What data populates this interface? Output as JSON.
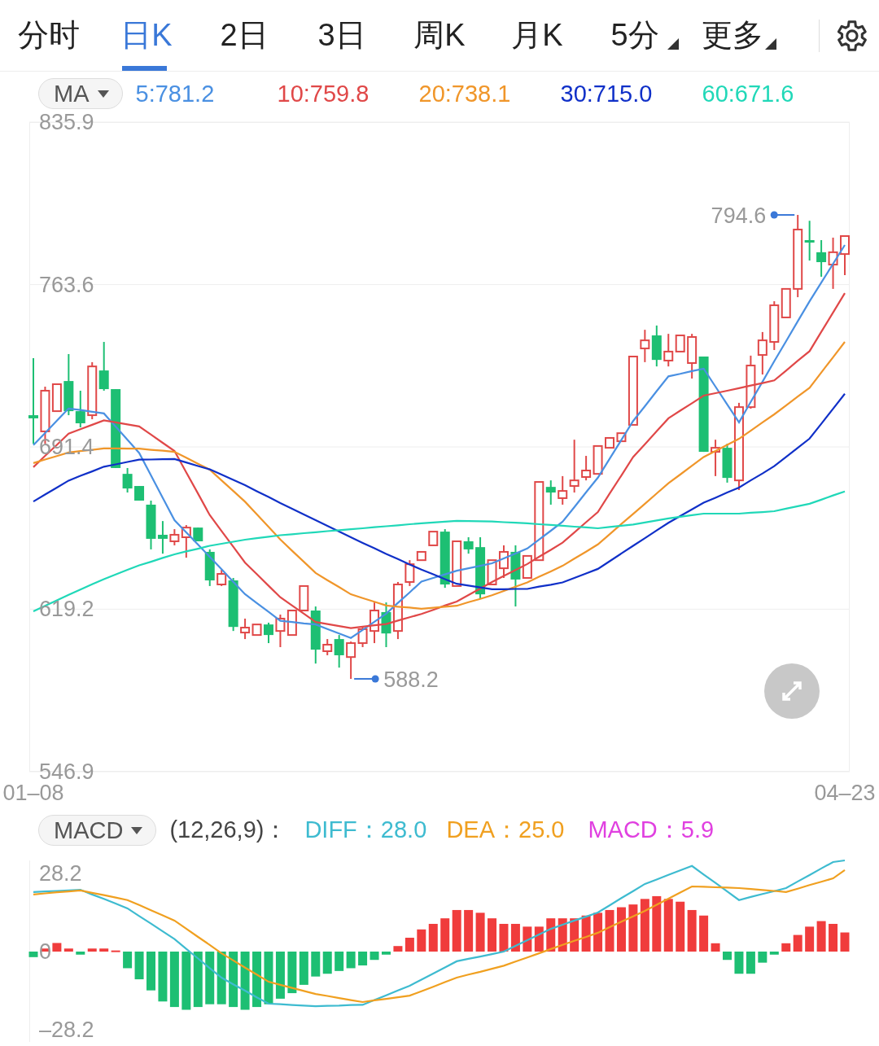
{
  "tabs": [
    {
      "label": "分时",
      "selected": false,
      "dropdown": false
    },
    {
      "label": "日K",
      "selected": true,
      "dropdown": false
    },
    {
      "label": "2日",
      "selected": false,
      "dropdown": false
    },
    {
      "label": "3日",
      "selected": false,
      "dropdown": false
    },
    {
      "label": "周K",
      "selected": false,
      "dropdown": false
    },
    {
      "label": "月K",
      "selected": false,
      "dropdown": false
    },
    {
      "label": "5分",
      "selected": false,
      "dropdown": true
    },
    {
      "label": "更多",
      "selected": false,
      "dropdown": true
    }
  ],
  "indicator_bar": {
    "selector": "MA",
    "values": [
      {
        "label": "5:781.2",
        "color": "#4a90e2"
      },
      {
        "label": "10:759.8",
        "color": "#e04848"
      },
      {
        "label": "20:738.1",
        "color": "#f0962a"
      },
      {
        "label": "30:715.0",
        "color": "#1030c8"
      },
      {
        "label": "60:671.6",
        "color": "#20d8b8"
      }
    ]
  },
  "price_chart": {
    "chart_data": {
      "type": "candlestick",
      "grid": true,
      "categories": [
        "01–08",
        null,
        null,
        null,
        null,
        null,
        null,
        null,
        null,
        null,
        null,
        null,
        null,
        null,
        null,
        null,
        null,
        null,
        null,
        null,
        null,
        null,
        null,
        null,
        null,
        null,
        null,
        null,
        null,
        null,
        null,
        null,
        null,
        null,
        null,
        null,
        null,
        null,
        null,
        null,
        null,
        null,
        null,
        null,
        null,
        null,
        null,
        null,
        null,
        null,
        null,
        null,
        null,
        null,
        null,
        null,
        null,
        null,
        null,
        null,
        null,
        null,
        null,
        null,
        null,
        null,
        null,
        null,
        null,
        "04–23"
      ],
      "ylim": [
        546.9,
        835.9
      ],
      "yticks": [
        {
          "value": 835.9,
          "label": "835.9"
        },
        {
          "value": 763.6,
          "label": "763.6"
        },
        {
          "value": 691.4,
          "label": "691.4"
        },
        {
          "value": 619.2,
          "label": "619.2"
        },
        {
          "value": 546.9,
          "label": "546.9"
        }
      ],
      "ohlc": [
        [
          705.5,
          730.9,
          692.8,
          704.1
        ],
        [
          698.3,
          718.2,
          692.8,
          716.4
        ],
        [
          707.3,
          719.3,
          707.3,
          719.3
        ],
        [
          720.7,
          732.7,
          705.5,
          707.3
        ],
        [
          707.3,
          716.4,
          700.1,
          701.9
        ],
        [
          705.5,
          729.1,
          703.7,
          727.2
        ],
        [
          725.4,
          738.1,
          716.4,
          717.1
        ],
        [
          717.1,
          717.1,
          682.0,
          682.0
        ],
        [
          679.4,
          682.0,
          671.1,
          672.9
        ],
        [
          674.0,
          674.0,
          667.5,
          667.5
        ],
        [
          665.7,
          667.5,
          645.8,
          650.5
        ],
        [
          652.3,
          658.4,
          643.9,
          650.5
        ],
        [
          649.4,
          654.8,
          647.6,
          652.3
        ],
        [
          651.2,
          656.6,
          642.1,
          655.5
        ],
        [
          655.5,
          655.5,
          649.4,
          649.4
        ],
        [
          644.7,
          645.8,
          629.5,
          632.0
        ],
        [
          630.2,
          636.7,
          629.5,
          634.9
        ],
        [
          632.0,
          633.1,
          609.5,
          611.3
        ],
        [
          608.8,
          615.0,
          605.9,
          611.0
        ],
        [
          607.7,
          612.4,
          607.7,
          612.4
        ],
        [
          612.4,
          613.2,
          604.1,
          607.7
        ],
        [
          609.5,
          616.8,
          602.3,
          615.0
        ],
        [
          607.7,
          618.6,
          607.7,
          618.6
        ],
        [
          618.6,
          629.5,
          618.6,
          629.5
        ],
        [
          618.6,
          620.4,
          595.0,
          601.2
        ],
        [
          600.5,
          605.9,
          598.7,
          603.4
        ],
        [
          605.9,
          607.7,
          593.2,
          598.7
        ],
        [
          597.9,
          604.8,
          588.2,
          604.1
        ],
        [
          604.1,
          611.3,
          602.3,
          610.3
        ],
        [
          609.5,
          622.2,
          604.1,
          618.6
        ],
        [
          617.9,
          622.2,
          602.3,
          608.4
        ],
        [
          609.5,
          631.3,
          605.9,
          630.2
        ],
        [
          631.3,
          641.0,
          629.5,
          639.2
        ],
        [
          641.0,
          644.7,
          641.0,
          644.7
        ],
        [
          647.6,
          653.7,
          647.6,
          653.7
        ],
        [
          653.7,
          654.8,
          628.7,
          630.2
        ],
        [
          629.5,
          649.4,
          629.5,
          649.4
        ],
        [
          649.4,
          651.2,
          643.9,
          645.8
        ],
        [
          646.8,
          651.2,
          624.0,
          625.8
        ],
        [
          630.2,
          641.0,
          630.2,
          641.0
        ],
        [
          637.4,
          647.6,
          633.1,
          644.7
        ],
        [
          644.7,
          647.6,
          620.4,
          632.4
        ],
        [
          633.1,
          642.9,
          633.1,
          642.9
        ],
        [
          641.0,
          675.8,
          641.0,
          675.8
        ],
        [
          673.6,
          676.5,
          665.7,
          671.1
        ],
        [
          668.6,
          678.4,
          665.7,
          671.8
        ],
        [
          674.0,
          694.6,
          671.1,
          676.5
        ],
        [
          678.0,
          687.4,
          676.5,
          680.9
        ],
        [
          679.4,
          691.8,
          679.4,
          691.8
        ],
        [
          691.0,
          695.4,
          691.0,
          695.4
        ],
        [
          693.9,
          697.5,
          693.9,
          697.5
        ],
        [
          701.2,
          731.6,
          701.2,
          731.6
        ],
        [
          735.2,
          743.5,
          729.1,
          738.8
        ],
        [
          741.0,
          745.4,
          727.2,
          730.1
        ],
        [
          729.8,
          741.7,
          727.2,
          733.8
        ],
        [
          733.8,
          741.0,
          733.8,
          741.0
        ],
        [
          728.7,
          741.7,
          721.8,
          740.3
        ],
        [
          731.6,
          731.6,
          689.2,
          689.2
        ],
        [
          689.2,
          694.6,
          678.4,
          691.0
        ],
        [
          691.0,
          692.8,
          675.5,
          677.6
        ],
        [
          676.5,
          711.0,
          672.2,
          709.1
        ],
        [
          709.1,
          732.0,
          708.4,
          727.6
        ],
        [
          732.3,
          742.5,
          723.6,
          738.8
        ],
        [
          738.1,
          756.2,
          734.5,
          754.4
        ],
        [
          749.0,
          761.7,
          749.0,
          761.7
        ],
        [
          761.7,
          794.6,
          758.0,
          788.1
        ],
        [
          783.4,
          792.0,
          774.3,
          782.3
        ],
        [
          778.0,
          783.4,
          767.1,
          773.6
        ],
        [
          772.5,
          784.5,
          761.7,
          778.0
        ],
        [
          777.2,
          785.2,
          767.8,
          785.2
        ]
      ],
      "series": [
        {
          "type": "line",
          "color": "#4a90e2",
          "values": [
            692.2,
            697.6,
            703.1,
            708.5,
            707.8,
            707.0,
            706.3,
            700.4,
            694.6,
            688.7,
            678.7,
            668.8,
            658.8,
            653.4,
            647.9,
            642.5,
            637.0,
            631.4,
            625.9,
            621.9,
            618.0,
            614.0,
            613.5,
            612.9,
            612.4,
            610.4,
            608.4,
            606.4,
            610.0,
            613.6,
            617.2,
            622.0,
            626.7,
            631.5,
            633.1,
            634.7,
            636.3,
            637.4,
            638.5,
            639.6,
            641.8,
            644.0,
            646.2,
            650.2,
            654.1,
            658.1,
            664.6,
            671.2,
            677.7,
            686.1,
            694.5,
            702.9,
            709.5,
            716.2,
            722.8,
            723.9,
            725.1,
            726.2,
            718.2,
            710.3,
            702.3,
            711.4,
            720.4,
            729.5,
            738.4,
            747.3,
            756.2,
            764.5,
            772.9,
            781.2
          ]
        },
        {
          "type": "line",
          "color": "#e04848",
          "values": [
            682.4,
            687.4,
            692.3,
            697.3,
            699.3,
            701.2,
            703.2,
            702.3,
            701.4,
            700.5,
            696.9,
            693.2,
            689.6,
            680.1,
            670.6,
            661.1,
            654.0,
            647.0,
            639.9,
            634.8,
            629.6,
            624.5,
            620.8,
            617.2,
            613.5,
            612.6,
            611.7,
            610.8,
            611.4,
            612.0,
            612.6,
            614.1,
            615.6,
            617.1,
            618.9,
            620.8,
            622.6,
            625.5,
            628.4,
            631.3,
            634.0,
            636.6,
            639.3,
            642.5,
            645.6,
            648.8,
            653.3,
            657.9,
            662.4,
            670.6,
            678.7,
            686.9,
            692.6,
            698.4,
            704.1,
            707.5,
            710.8,
            714.2,
            715.3,
            716.4,
            717.5,
            718.7,
            719.8,
            721.0,
            725.3,
            729.7,
            734.0,
            742.6,
            751.2,
            759.8
          ]
        },
        {
          "type": "line",
          "color": "#f0962a",
          "values": [
            684.2,
            685.8,
            687.3,
            688.9,
            689.5,
            690.1,
            690.7,
            690.7,
            690.6,
            690.6,
            690.1,
            689.7,
            689.2,
            686.6,
            683.9,
            681.3,
            676.5,
            671.8,
            667.0,
            661.4,
            655.8,
            650.2,
            645.2,
            640.3,
            635.3,
            632.1,
            629.0,
            625.8,
            624.1,
            622.5,
            620.8,
            620.3,
            619.9,
            619.4,
            619.8,
            620.3,
            620.7,
            622.3,
            623.8,
            625.4,
            627.3,
            629.2,
            631.1,
            633.6,
            636.0,
            638.5,
            641.7,
            644.8,
            648.0,
            652.5,
            657.1,
            661.6,
            666.1,
            670.7,
            675.2,
            679.1,
            683.0,
            686.9,
            689.6,
            692.3,
            695.0,
            698.6,
            702.3,
            705.9,
            709.8,
            713.8,
            717.7,
            724.5,
            731.3,
            738.1
          ]
        },
        {
          "type": "line",
          "color": "#1030c8",
          "values": [
            667.1,
            670.2,
            673.3,
            676.4,
            678.5,
            680.5,
            682.6,
            683.6,
            684.7,
            685.7,
            685.8,
            685.9,
            686.0,
            684.5,
            682.9,
            681.4,
            679.1,
            676.7,
            674.4,
            671.7,
            669.1,
            666.4,
            663.9,
            661.3,
            658.8,
            656.3,
            653.7,
            651.2,
            648.7,
            646.3,
            643.8,
            641.5,
            639.1,
            636.8,
            634.7,
            632.6,
            630.5,
            629.7,
            628.9,
            628.1,
            628.1,
            628.2,
            628.2,
            629.2,
            630.1,
            631.1,
            633.1,
            635.1,
            637.1,
            640.5,
            644.0,
            647.4,
            650.8,
            654.2,
            657.6,
            660.6,
            663.6,
            666.6,
            668.8,
            671.1,
            673.3,
            676.5,
            679.6,
            682.8,
            686.9,
            691.0,
            695.1,
            701.7,
            708.4,
            715.0
          ]
        },
        {
          "type": "line",
          "color": "#20d8b8",
          "values": [
            618.2,
            620.7,
            623.1,
            625.6,
            627.9,
            630.3,
            632.6,
            634.6,
            636.7,
            638.7,
            640.3,
            642.0,
            643.6,
            644.9,
            646.1,
            647.4,
            648.3,
            649.2,
            650.1,
            650.8,
            651.4,
            652.1,
            652.5,
            653.0,
            653.4,
            653.9,
            654.3,
            654.8,
            655.2,
            655.7,
            656.1,
            656.5,
            657.0,
            657.4,
            657.8,
            658.1,
            658.5,
            658.4,
            658.3,
            658.2,
            657.9,
            657.7,
            657.4,
            657.0,
            656.7,
            656.3,
            655.9,
            655.6,
            655.2,
            655.8,
            656.3,
            656.9,
            657.8,
            658.7,
            659.6,
            660.3,
            661.0,
            661.7,
            661.7,
            661.7,
            661.7,
            662.1,
            662.4,
            662.8,
            663.9,
            665.0,
            666.1,
            667.9,
            669.8,
            671.6
          ]
        }
      ],
      "annotations": [
        {
          "text": "794.6"
        },
        {
          "text": "588.2"
        }
      ]
    }
  },
  "macd_bar": {
    "selector": "MACD",
    "params": "(12,26,9)：",
    "values": [
      {
        "label": "DIFF：28.0",
        "color": "#3ebbd0"
      },
      {
        "label": "DEA：25.0",
        "color": "#f0a020"
      },
      {
        "label": "MACD：5.9",
        "color": "#e040e0"
      }
    ]
  },
  "macd_chart": {
    "chart_data": {
      "type": "bar",
      "ylim": [
        -32.6,
        32.9
      ],
      "categories": [
        null,
        null,
        null,
        null,
        null,
        null,
        null,
        null,
        null,
        null,
        null,
        null,
        null,
        null,
        null,
        null,
        null,
        null,
        null,
        null,
        null,
        null,
        null,
        null,
        null,
        null,
        null,
        null,
        null,
        null,
        null,
        null,
        null,
        null,
        null,
        null,
        null,
        null,
        null,
        null,
        null,
        null,
        null,
        null,
        null,
        null,
        null,
        null,
        null,
        null,
        null,
        null,
        null,
        null,
        null,
        null,
        null,
        null,
        null,
        null,
        null,
        null,
        null,
        null,
        null,
        null,
        null,
        null,
        null,
        null
      ],
      "yticks": [
        {
          "value": 28.2,
          "label": "28.2"
        },
        {
          "value": 0,
          "label": "0"
        },
        {
          "value": -28.2,
          "label": "–28.2"
        }
      ],
      "series": [
        {
          "type": "bar",
          "color": "#f03c3c",
          "values": [
            null,
            1.1,
            3.1,
            1.1,
            null,
            1.1,
            1.1,
            0.4,
            null,
            null,
            null,
            null,
            null,
            null,
            null,
            null,
            null,
            null,
            null,
            null,
            null,
            null,
            null,
            null,
            null,
            null,
            null,
            null,
            null,
            null,
            null,
            2,
            5,
            8,
            10,
            12,
            15,
            15,
            14,
            12,
            10,
            10,
            9,
            9,
            12,
            12,
            12,
            13,
            14,
            15,
            16,
            17,
            19,
            20,
            19,
            18,
            15,
            13,
            3,
            null,
            null,
            null,
            null,
            null,
            3,
            6,
            9,
            11,
            10,
            6.9
          ]
        },
        {
          "type": "bar",
          "color": "#1dbf73",
          "values": [
            -2,
            null,
            null,
            null,
            -1.1,
            null,
            null,
            null,
            -6,
            -10,
            -14,
            -18,
            -20,
            -21,
            -20,
            -19,
            -19,
            -20,
            -21,
            -20,
            -19,
            -17,
            -15,
            -12,
            -9,
            -8,
            -7,
            -6,
            -5,
            -3,
            -1.1,
            null,
            null,
            null,
            null,
            null,
            null,
            null,
            null,
            null,
            null,
            null,
            null,
            null,
            null,
            null,
            null,
            null,
            null,
            null,
            null,
            null,
            null,
            null,
            null,
            null,
            null,
            null,
            null,
            -3,
            -8,
            -8,
            -4,
            -1.1,
            null,
            null,
            null,
            null,
            null,
            null
          ]
        },
        {
          "type": "line",
          "color": "#3ebbd0",
          "values": [
            21.5,
            21.7,
            21.9,
            22.1,
            22.3,
            20.6,
            19.0,
            17.3,
            15.6,
            12.8,
            10.1,
            7.3,
            4.5,
            1.0,
            -2.5,
            -6.0,
            -9.4,
            -11.8,
            -14.1,
            -16.5,
            -18.8,
            -19.0,
            -19.3,
            -19.5,
            -19.7,
            -19.6,
            -19.5,
            -19.3,
            -19.2,
            -17.5,
            -15.8,
            -14.0,
            -12.3,
            -10.1,
            -7.9,
            -5.7,
            -3.5,
            -2.6,
            -1.8,
            -0.9,
            0,
            2.1,
            4.1,
            6.2,
            8.2,
            9.7,
            11.2,
            12.6,
            14.1,
            16.7,
            19.3,
            21.8,
            24.4,
            26.0,
            27.7,
            29.3,
            30.9,
            27.8,
            24.8,
            21.7,
            18.6,
            19.7,
            20.8,
            21.8,
            22.9,
            25.3,
            27.6,
            30.0,
            32.3,
            32.9
          ]
        },
        {
          "type": "line",
          "color": "#f0a020",
          "values": [
            20.6,
            21.0,
            21.4,
            21.7,
            22.1,
            21.2,
            20.4,
            19.5,
            18.6,
            16.8,
            14.9,
            13.1,
            11.2,
            8.3,
            5.3,
            2.4,
            -0.6,
            -3.2,
            -5.8,
            -8.3,
            -10.9,
            -12.0,
            -13.1,
            -14.2,
            -15.3,
            -16.0,
            -16.8,
            -17.5,
            -18.2,
            -17.6,
            -17.1,
            -16.5,
            -15.9,
            -14.3,
            -12.7,
            -11.0,
            -9.4,
            -8.3,
            -7.3,
            -6.2,
            -5.1,
            -3.6,
            -2.1,
            -0.6,
            0.9,
            2.4,
            3.9,
            5.3,
            6.8,
            8.8,
            10.8,
            12.7,
            14.7,
            16.9,
            19.1,
            21.3,
            23.5,
            23.4,
            23.2,
            23.1,
            22.9,
            22.6,
            22.2,
            21.9,
            21.5,
            22.7,
            24.0,
            25.2,
            26.4,
            29.4
          ]
        }
      ]
    }
  }
}
